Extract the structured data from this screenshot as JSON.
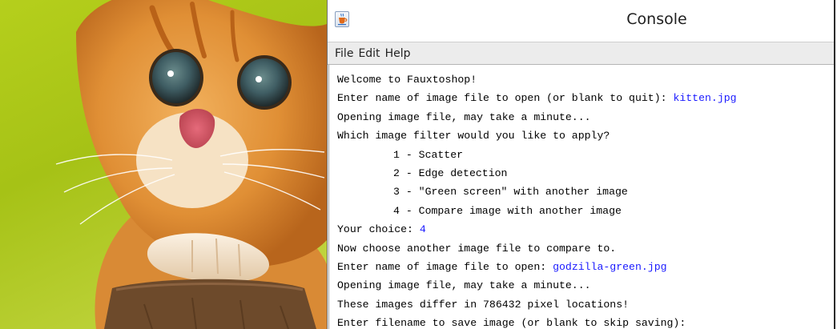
{
  "window": {
    "title": "Console",
    "icon": "java-cup-icon"
  },
  "menu": {
    "items": [
      "File",
      "Edit",
      "Help"
    ]
  },
  "console": {
    "colors": {
      "output": "#000000",
      "user_input": "#1a1aff"
    },
    "lines": [
      {
        "text": "Welcome to Fauxtoshop!",
        "input": ""
      },
      {
        "text": "Enter name of image file to open (or blank to quit): ",
        "input": "kitten.jpg"
      },
      {
        "text": "Opening image file, may take a minute...",
        "input": ""
      },
      {
        "text": "Which image filter would you like to apply?",
        "input": ""
      },
      {
        "text": "1 - Scatter",
        "input": ""
      },
      {
        "text": "2 - Edge detection",
        "input": ""
      },
      {
        "text": "3 - \"Green screen\" with another image",
        "input": ""
      },
      {
        "text": "4 - Compare image with another image",
        "input": ""
      },
      {
        "text": "Your choice: ",
        "input": "4"
      },
      {
        "text": "Now choose another image file to compare to.",
        "input": ""
      },
      {
        "text": "Enter name of image file to open: ",
        "input": "godzilla-green.jpg"
      },
      {
        "text": "Opening image file, may take a minute...",
        "input": ""
      },
      {
        "text": "These images differ in 786432 pixel locations!",
        "input": ""
      },
      {
        "text": "Enter filename to save image (or blank to skip saving):",
        "input": ""
      }
    ]
  }
}
